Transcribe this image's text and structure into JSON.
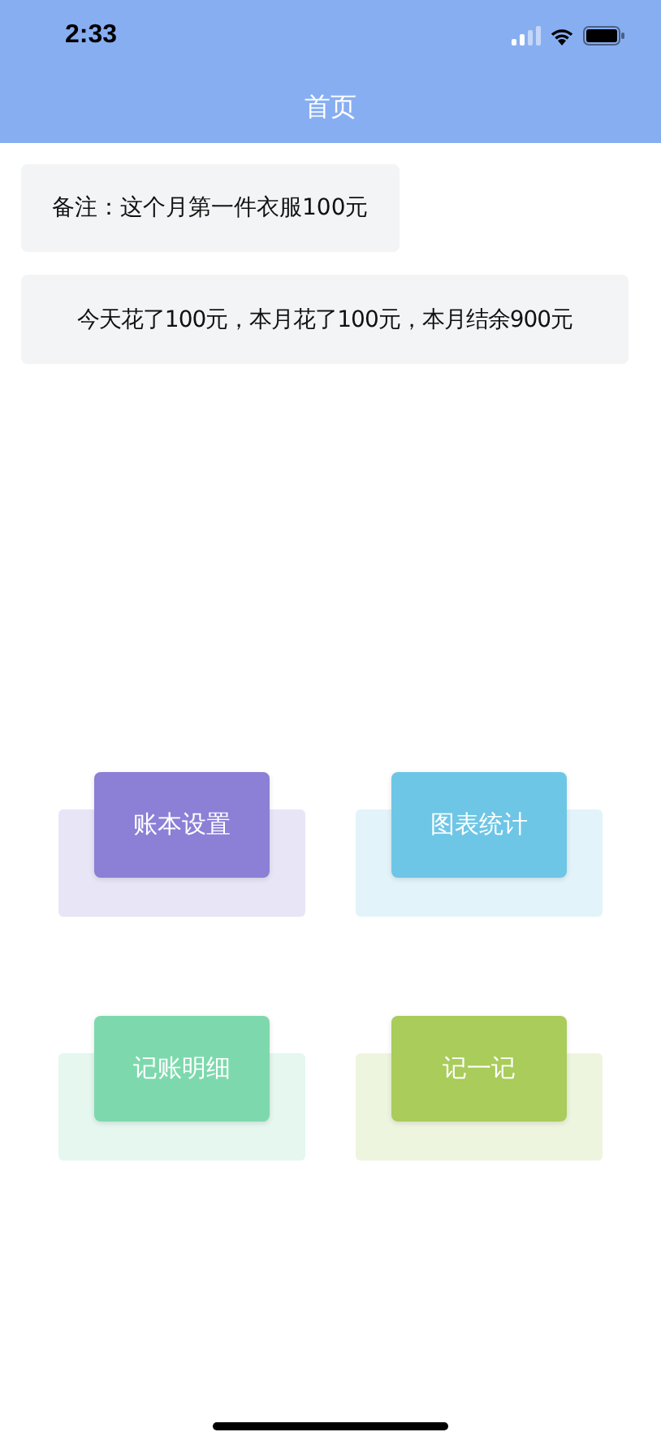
{
  "status_bar": {
    "time": "2:33"
  },
  "nav_bar": {
    "title": "首页"
  },
  "note": "备注：这个月第一件衣服100元",
  "summary": "今天花了100元，本月花了100元，本月结余900元",
  "tiles": [
    {
      "label": "账本设置",
      "color": "#8b7fd6"
    },
    {
      "label": "图表统计",
      "color": "#6ec6e6"
    },
    {
      "label": "记账明细",
      "color": "#7dd9ad"
    },
    {
      "label": "记一记",
      "color": "#a9cc5a"
    }
  ]
}
